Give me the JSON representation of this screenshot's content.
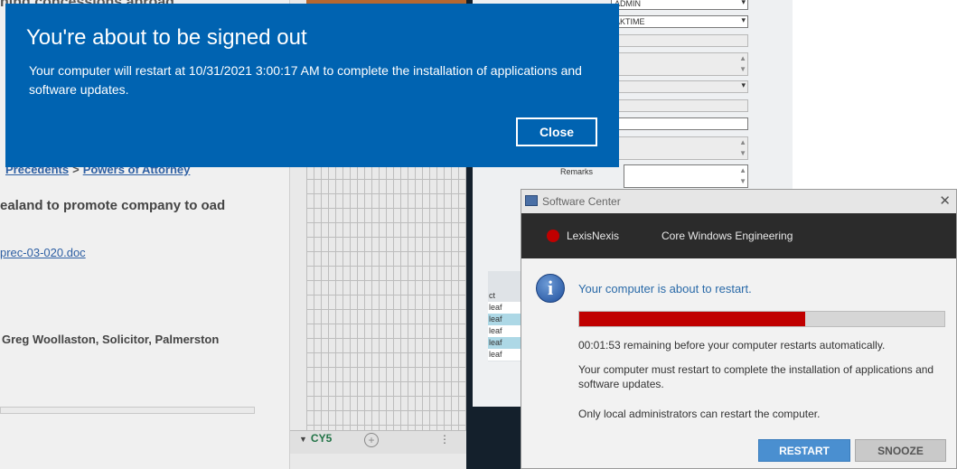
{
  "toast": {
    "title": "You're about to be signed out",
    "message": "Your computer will restart at 10/31/2021 3:00:17 AM to complete the installation of applications and software updates.",
    "close_label": "Close",
    "bg_color": "#0063b1"
  },
  "background_doc": {
    "heading_fragment": "ning concessions abroad",
    "breadcrumb_precedents": "Precedents",
    "breadcrumb_separator": ">",
    "breadcrumb_powers": "Powers of Attorney",
    "title_line": "ealand to promote company to oad",
    "file_link": "prec-03-020.doc",
    "author": "Greg Woollaston, Solicitor, Palmerston"
  },
  "spreadsheet": {
    "active_tab": "CY5"
  },
  "form": {
    "dropdown1_value": "ADMIN",
    "dropdown2_value": "AKTIME",
    "remarks_label": "Remarks",
    "mini_table": {
      "header": "ct",
      "rows": [
        "leaf",
        "leaf",
        "leaf",
        "leaf",
        "leaf"
      ]
    }
  },
  "software_center": {
    "window_title": "Software Center",
    "brand": "LexisNexis",
    "org_name": "Core Windows Engineering",
    "heading": "Your computer is about to restart.",
    "progress_fraction": 0.62,
    "countdown": "00:01:53 remaining before your computer restarts automatically.",
    "body": "Your computer must restart to complete the installation of applications and software updates.",
    "admin_note": "Only local administrators can restart the computer.",
    "restart_label": "RESTART",
    "snooze_label": "SNOOZE",
    "progress_color": "#c00000"
  }
}
